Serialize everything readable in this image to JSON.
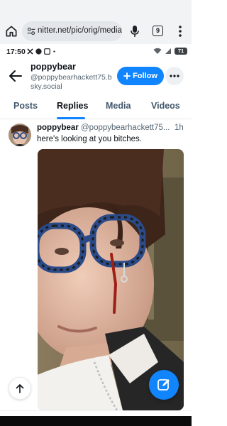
{
  "browser": {
    "url": "nitter.net/pic/orig/media",
    "tab_count": "9"
  },
  "status_bar": {
    "time": "17:50",
    "battery": "71"
  },
  "profile": {
    "name": "poppybear",
    "handle": "@poppybearhackett75.bsky.social",
    "follow_label": "Follow"
  },
  "tabs": [
    {
      "label": "Posts"
    },
    {
      "label": "Replies"
    },
    {
      "label": "Media"
    },
    {
      "label": "Videos"
    }
  ],
  "active_tab": "Replies",
  "post": {
    "author": "poppybear",
    "handle": "@poppybearhackett75...",
    "time": "1h",
    "text": "here's looking at you bitches."
  },
  "colors": {
    "accent": "#1185fe",
    "text": "#0f1419",
    "muted": "#536471",
    "chrome": "#f1f3f4"
  },
  "icons": {
    "home": "home-icon",
    "site_settings": "tune-icon",
    "mic": "mic-icon",
    "menu": "more-vert-icon",
    "back": "arrow-left-icon",
    "more": "ellipsis-icon",
    "scroll_top": "arrow-up-icon",
    "compose": "compose-icon"
  }
}
